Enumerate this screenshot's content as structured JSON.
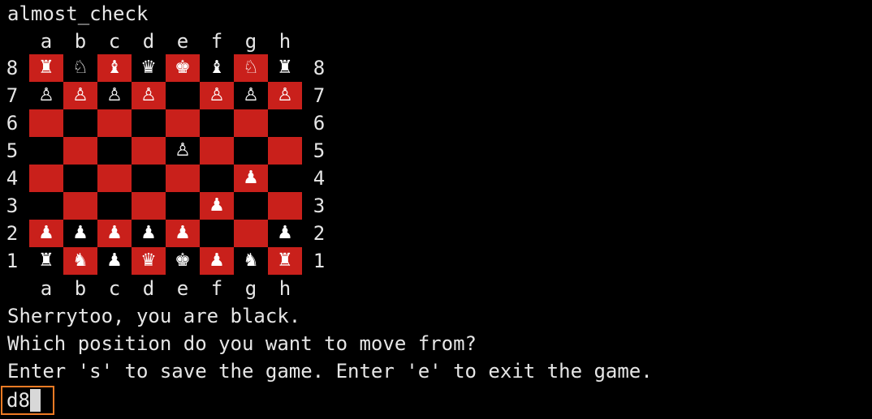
{
  "terminal": {
    "title_line": "almost_check",
    "files": [
      "a",
      "b",
      "c",
      "d",
      "e",
      "f",
      "g",
      "h"
    ],
    "ranks": [
      "8",
      "7",
      "6",
      "5",
      "4",
      "3",
      "2",
      "1"
    ],
    "board": [
      [
        "♜",
        "♘",
        "♝",
        "♛",
        "♚",
        "♝",
        "♘",
        "♜"
      ],
      [
        "♙",
        "♙",
        "♙",
        "♙",
        "",
        "♙",
        "♙",
        "♙"
      ],
      [
        "",
        "",
        "",
        "",
        "",
        "",
        "",
        ""
      ],
      [
        "",
        "",
        "",
        "",
        "♙",
        "",
        "",
        ""
      ],
      [
        "",
        "",
        "",
        "",
        "",
        "",
        "♟",
        ""
      ],
      [
        "",
        "",
        "",
        "",
        "",
        "♟",
        "",
        ""
      ],
      [
        "♟",
        "♟",
        "♟",
        "♟",
        "♟",
        "",
        "",
        "♟"
      ],
      [
        "♜",
        "♞",
        "♟",
        "♛",
        "♚",
        "♟",
        "♞",
        "♜"
      ]
    ],
    "messages": [
      "Sherrytoo, you are black.",
      "Which position do you want to move from?",
      "Enter 's' to save the game. Enter 'e' to exit the game."
    ],
    "input_value": "d8",
    "colors": {
      "background": "#000000",
      "light_square": "#c9201b",
      "dark_square": "#000000",
      "text": "#e6e6e6",
      "input_highlight": "#f07b24"
    }
  }
}
